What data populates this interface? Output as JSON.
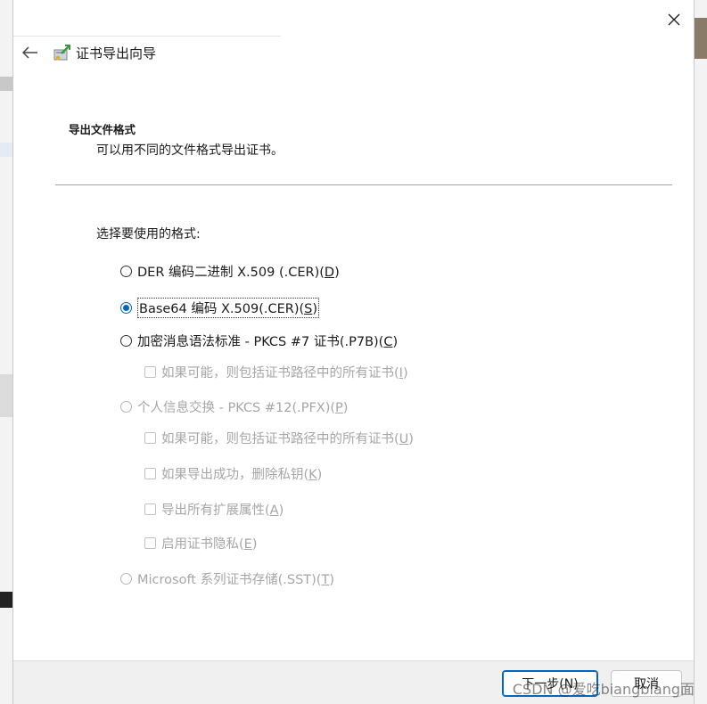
{
  "wizard": {
    "title": "证书导出向导",
    "section_title": "导出文件格式",
    "section_desc": "可以用不同的文件格式导出证书。",
    "prompt": "选择要使用的格式:"
  },
  "options": {
    "der": {
      "label": "DER 编码二进制 X.509 (.CER)(",
      "key": "D",
      "end": ")"
    },
    "base64": {
      "label": "Base64 编码 X.509(.CER)(",
      "key": "S",
      "end": ")"
    },
    "pkcs7": {
      "label": "加密消息语法标准 - PKCS #7 证书(.P7B)(",
      "key": "C",
      "end": ")"
    },
    "pkcs7_include": {
      "label": "如果可能，则包括证书路径中的所有证书(",
      "key": "I",
      "end": ")"
    },
    "pfx": {
      "label": "个人信息交换 - PKCS #12(.PFX)(",
      "key": "P",
      "end": ")"
    },
    "pfx_include": {
      "label": "如果可能，则包括证书路径中的所有证书(",
      "key": "U",
      "end": ")"
    },
    "pfx_delete_key": {
      "label": "如果导出成功，删除私钥(",
      "key": "K",
      "end": ")"
    },
    "pfx_ext": {
      "label": "导出所有扩展属性(",
      "key": "A",
      "end": ")"
    },
    "pfx_privacy": {
      "label": "启用证书隐私(",
      "key": "E",
      "end": ")"
    },
    "sst": {
      "label": "Microsoft 系列证书存储(.SST)(",
      "key": "T",
      "end": ")"
    }
  },
  "footer": {
    "next_label": "下一步(N)",
    "cancel_label": "取消"
  },
  "watermark": "CSDN @爱吃biangbiang面",
  "colors": {
    "accent": "#0067c0",
    "disabled": "#a6a6a6"
  }
}
